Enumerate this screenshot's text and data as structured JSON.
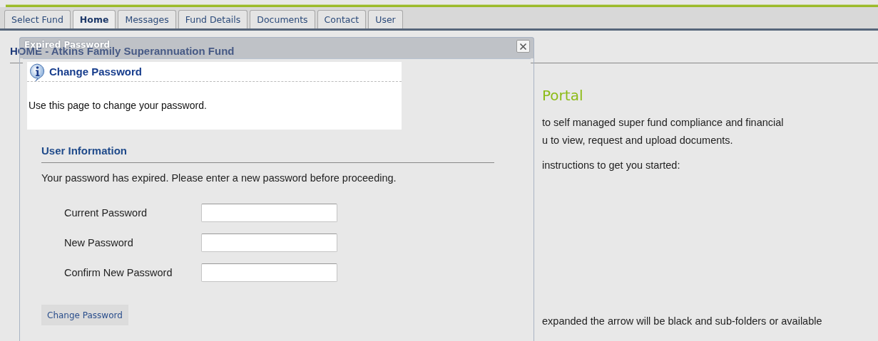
{
  "tabs": [
    {
      "label": "Select Fund",
      "selected": false
    },
    {
      "label": "Home",
      "selected": true
    },
    {
      "label": "Messages",
      "selected": false
    },
    {
      "label": "Fund Details",
      "selected": false
    },
    {
      "label": "Documents",
      "selected": false
    },
    {
      "label": "Contact",
      "selected": false
    },
    {
      "label": "User",
      "selected": false
    }
  ],
  "page": {
    "heading": "HOME - Atkins Family Superannuation Fund",
    "title": "Portal",
    "paragraphs": [
      [
        "to self managed super fund compliance and financial",
        "u to view, request and upload documents."
      ],
      [
        "instructions to get you started:"
      ]
    ],
    "footer_line": "expanded the arrow will be black and sub-folders or available"
  },
  "dialog": {
    "title": "Expired Password",
    "panel": {
      "heading": "Change Password",
      "text": "Use this page to change your password."
    },
    "section": "User Information",
    "message": "Your password has expired. Please enter a new password before proceeding.",
    "fields": [
      {
        "label": "Current Password"
      },
      {
        "label": "New Password"
      },
      {
        "label": "Confirm New Password"
      }
    ],
    "button": "Change Password"
  }
}
